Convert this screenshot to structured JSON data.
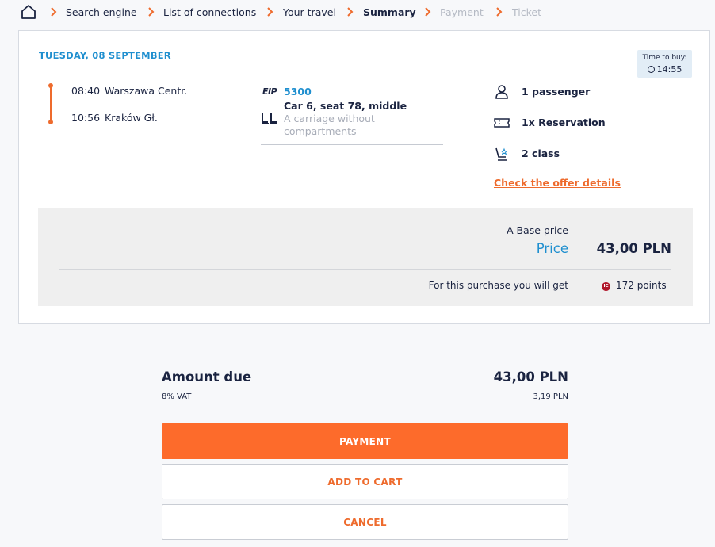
{
  "breadcrumb": {
    "items": [
      "Search engine",
      "List of connections",
      "Your travel",
      "Summary",
      "Payment",
      "Ticket"
    ]
  },
  "journey": {
    "date": "TUESDAY, 08 SEPTEMBER",
    "time_to_buy_label": "Time to buy:",
    "time_to_buy_value": "14:55",
    "departure": {
      "time": "08:40",
      "station": "Warszawa Centr."
    },
    "arrival": {
      "time": "10:56",
      "station": "Kraków Gł."
    },
    "train_category": "EIP",
    "train_number": "5300",
    "seat": "Car 6, seat 78, middle",
    "carriage_type": "A carriage without compartments",
    "passengers": "1 passenger",
    "reservation": "1x Reservation",
    "travel_class": "2 class",
    "offer_details_link": "Check the offer details"
  },
  "pricing": {
    "tariff": "A-Base price",
    "price_label": "Price",
    "price_value": "43,00 PLN",
    "points_label": "For this purchase you will get",
    "points_badge": "IC",
    "points_value": "172 points"
  },
  "summary": {
    "amount_due_label": "Amount due",
    "amount_due_value": "43,00 PLN",
    "vat_label": "8% VAT",
    "vat_value": "3,19 PLN"
  },
  "actions": {
    "payment": "PAYMENT",
    "add_to_cart": "ADD TO CART",
    "cancel": "CANCEL"
  },
  "colors": {
    "accent_orange": "#fd6b2b",
    "accent_blue": "#1f8fcf",
    "text_dark": "#1a2340",
    "disabled": "#b5bac4"
  }
}
